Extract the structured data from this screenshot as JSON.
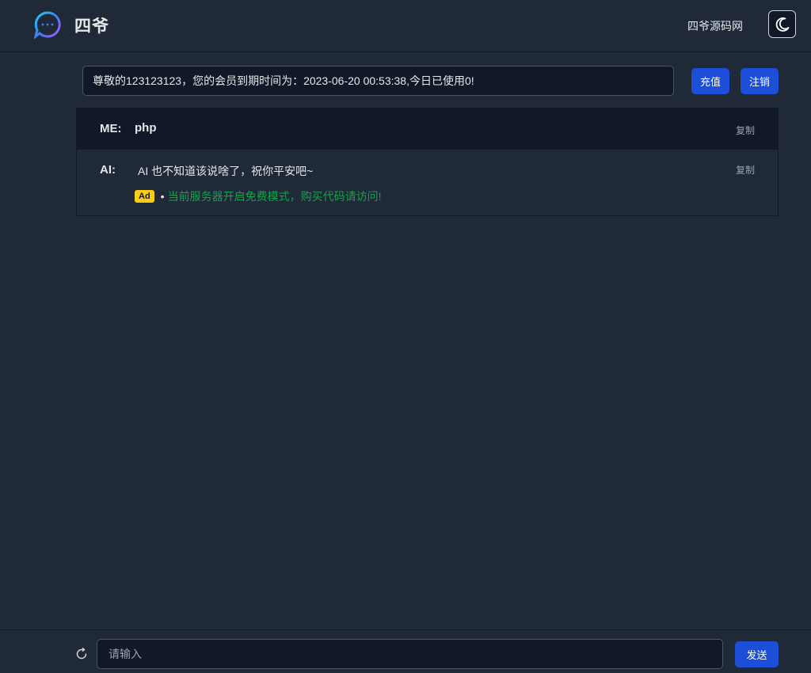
{
  "header": {
    "brand": "四爷",
    "site_link": "四爷源码网",
    "logo_icon": "chat-bubble-icon",
    "theme_icon": "moon-icon"
  },
  "status": {
    "text": "尊敬的123123123，您的会员到期时间为：2023-06-20 00:53:38,今日已使用0!",
    "recharge_label": "充值",
    "logout_label": "注销"
  },
  "messages": [
    {
      "role": "ME:",
      "text": "php",
      "copy_label": "复制"
    },
    {
      "role": "AI:",
      "text": "AI 也不知道该说啥了，祝你平安吧~",
      "copy_label": "复制"
    }
  ],
  "ad": {
    "badge": "Ad",
    "bullet": "•",
    "text": "当前服务器开启免费模式，购买代码请访问!"
  },
  "composer": {
    "placeholder": "请输入",
    "send_label": "发送",
    "refresh_icon": "refresh-icon"
  },
  "colors": {
    "background": "#1f2937",
    "panel": "#111827",
    "accent": "#1d4ed8",
    "ad_badge": "#facc15",
    "ad_text": "#16a34a"
  }
}
